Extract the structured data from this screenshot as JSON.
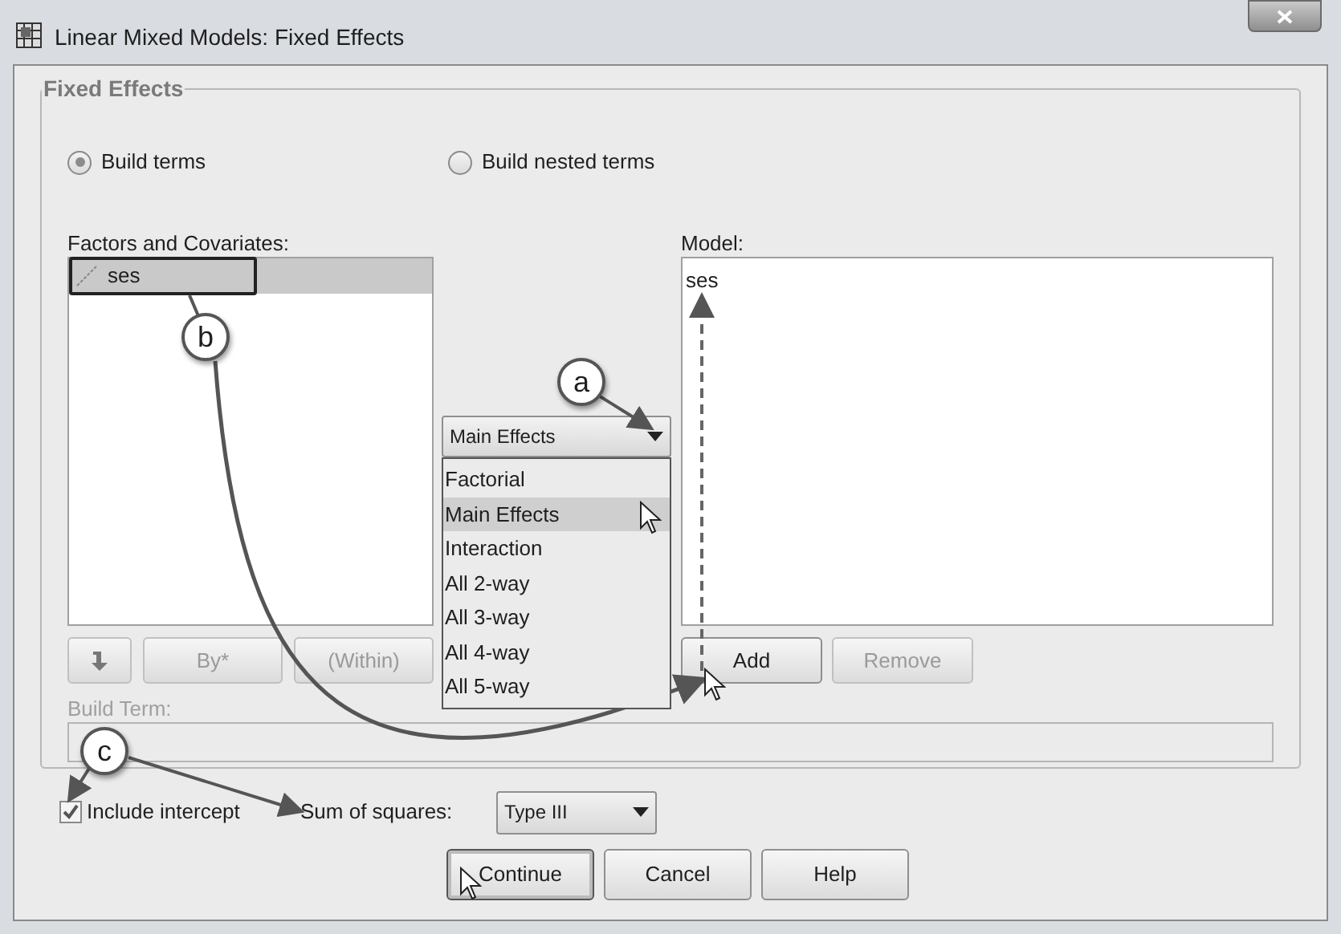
{
  "window": {
    "title": "Linear Mixed Models: Fixed Effects"
  },
  "group": {
    "title": "Fixed Effects"
  },
  "build_mode": [
    {
      "label": "Build terms",
      "selected": true
    },
    {
      "label": "Build nested terms",
      "selected": false
    }
  ],
  "factors": {
    "label": "Factors and Covariates:",
    "items": [
      {
        "name": "ses",
        "selected": true
      }
    ]
  },
  "term_type": {
    "value": "Main Effects",
    "expanded": true,
    "options": [
      {
        "label": "Factorial",
        "selected": false
      },
      {
        "label": "Main Effects",
        "selected": true
      },
      {
        "label": "Interaction",
        "selected": false
      },
      {
        "label": "All 2-way",
        "selected": false
      },
      {
        "label": "All 3-way",
        "selected": false
      },
      {
        "label": "All 4-way",
        "selected": false
      },
      {
        "label": "All 5-way",
        "selected": false
      }
    ]
  },
  "model": {
    "label": "Model:",
    "items": [
      "ses"
    ]
  },
  "term_buttons": [
    {
      "kind": "arrow",
      "disabled": true
    },
    {
      "kind": "text",
      "label": "By*",
      "disabled": true
    },
    {
      "kind": "text",
      "label": "(Within)",
      "disabled": true
    }
  ],
  "model_buttons": [
    {
      "label": "Add",
      "disabled": false
    },
    {
      "label": "Remove",
      "disabled": true
    }
  ],
  "build_term": {
    "label": "Build Term:",
    "disabled": true
  },
  "include_intercept": {
    "label": "Include intercept",
    "checked": true
  },
  "sum_of_squares": {
    "label": "Sum of squares:",
    "value": "Type III"
  },
  "buttons": [
    {
      "label": "Continue",
      "focused": true
    },
    {
      "label": "Cancel",
      "focused": false
    },
    {
      "label": "Help",
      "focused": false
    }
  ],
  "callouts": [
    {
      "letter": "a"
    },
    {
      "letter": "b"
    },
    {
      "letter": "c"
    }
  ]
}
